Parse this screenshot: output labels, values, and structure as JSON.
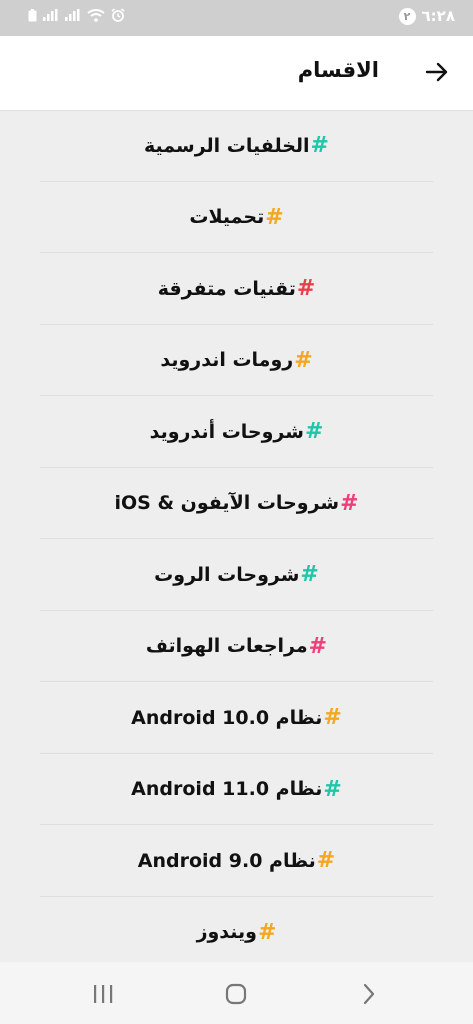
{
  "status_bar": {
    "time": "٦:٢٨",
    "notification_count": "٢"
  },
  "header": {
    "title": "الاقسام"
  },
  "categories": [
    {
      "label": "الخلفيات الرسمية",
      "hash": "#",
      "hash_color": "#20c6a8"
    },
    {
      "label": "تحميلات",
      "hash": "#",
      "hash_color": "#f5a623"
    },
    {
      "label": "تقنيات متفرقة",
      "hash": "#",
      "hash_color": "#e8404a"
    },
    {
      "label": "رومات اندرويد",
      "hash": "#",
      "hash_color": "#f5a623"
    },
    {
      "label": "شروحات أندرويد",
      "hash": "#",
      "hash_color": "#20c6a8"
    },
    {
      "label": "شروحات الآيفون & iOS",
      "hash": "#",
      "hash_color": "#ec407a"
    },
    {
      "label": "شروحات الروت",
      "hash": "#",
      "hash_color": "#20c6a8"
    },
    {
      "label": "مراجعات الهواتف",
      "hash": "#",
      "hash_color": "#ec407a"
    },
    {
      "label": "نظام Android 10.0",
      "hash": "#",
      "hash_color": "#f5a623"
    },
    {
      "label": "نظام Android 11.0",
      "hash": "#",
      "hash_color": "#20c6a8"
    },
    {
      "label": "نظام Android 9.0",
      "hash": "#",
      "hash_color": "#f5a623"
    },
    {
      "label": "ويندوز",
      "hash": "#",
      "hash_color": "#f5a623"
    }
  ],
  "nav_bar": {
    "icons": [
      "recent-apps-icon",
      "home-icon",
      "back-icon"
    ]
  }
}
